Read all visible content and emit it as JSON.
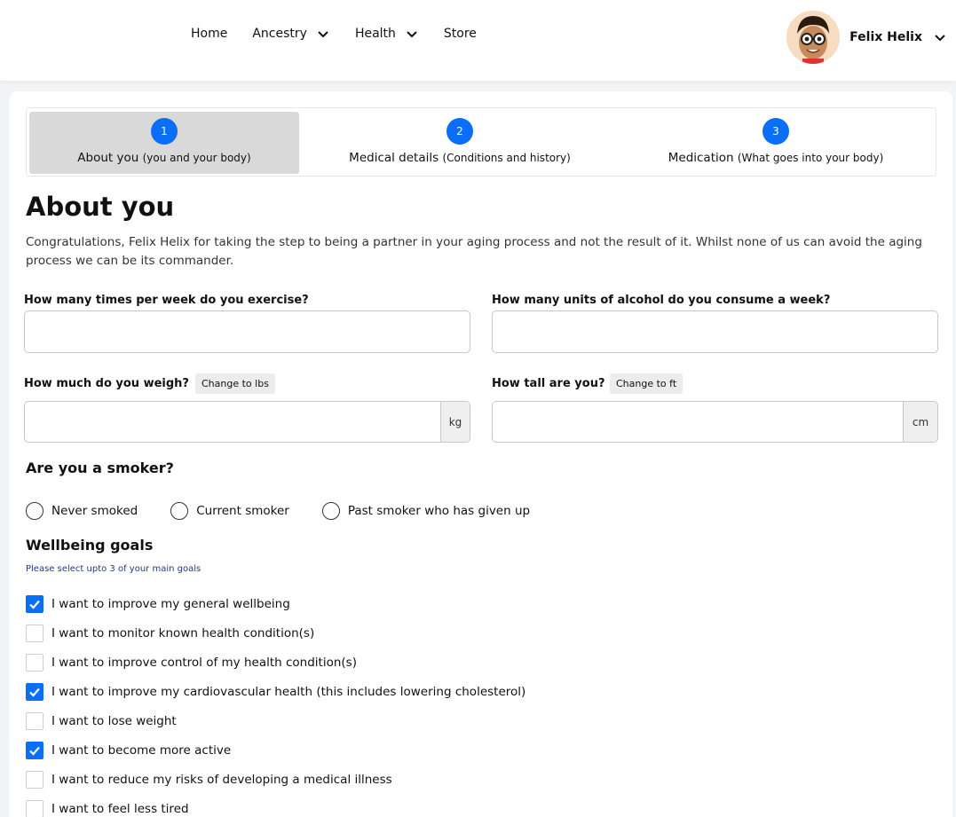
{
  "nav": {
    "home": "Home",
    "ancestry": "Ancestry",
    "health": "Health",
    "store": "Store"
  },
  "user": {
    "name": "Felix Helix"
  },
  "steps": [
    {
      "num": "1",
      "title": "About you",
      "sub": "(you and your body)",
      "active": true
    },
    {
      "num": "2",
      "title": "Medical details",
      "sub": "(Conditions and history)",
      "active": false
    },
    {
      "num": "3",
      "title": "Medication",
      "sub": "(What goes into your body)",
      "active": false
    }
  ],
  "page": {
    "title": "About you",
    "intro": "Congratulations, Felix Helix for taking the step to being a partner in your aging process and not the result of it. Whilst none of us can avoid the aging process we can be its commander."
  },
  "fields": {
    "exercise_label": "How many times per week do you exercise?",
    "alcohol_label": "How many units of alcohol do you consume a week?",
    "weight_label": "How much do you weigh?",
    "weight_toggle": "Change to lbs",
    "weight_unit": "kg",
    "height_label": "How tall are you?",
    "height_toggle": "Change to ft",
    "height_unit": "cm"
  },
  "smoker": {
    "title": "Are you a smoker?",
    "options": [
      "Never smoked",
      "Current smoker",
      "Past smoker who has given up"
    ]
  },
  "goals": {
    "title": "Wellbeing goals",
    "hint": "Please select upto 3 of your main goals",
    "items": [
      {
        "label": "I want to improve my general wellbeing",
        "checked": true
      },
      {
        "label": "I want to monitor known health condition(s)",
        "checked": false
      },
      {
        "label": "I want to improve control of my health condition(s)",
        "checked": false
      },
      {
        "label": "I want to improve my cardiovascular health (this includes lowering cholesterol)",
        "checked": true
      },
      {
        "label": "I want to lose weight",
        "checked": false
      },
      {
        "label": "I want to become more active",
        "checked": true
      },
      {
        "label": "I want to reduce my risks of developing a medical illness",
        "checked": false
      },
      {
        "label": "I want to feel less tired",
        "checked": false
      }
    ]
  }
}
